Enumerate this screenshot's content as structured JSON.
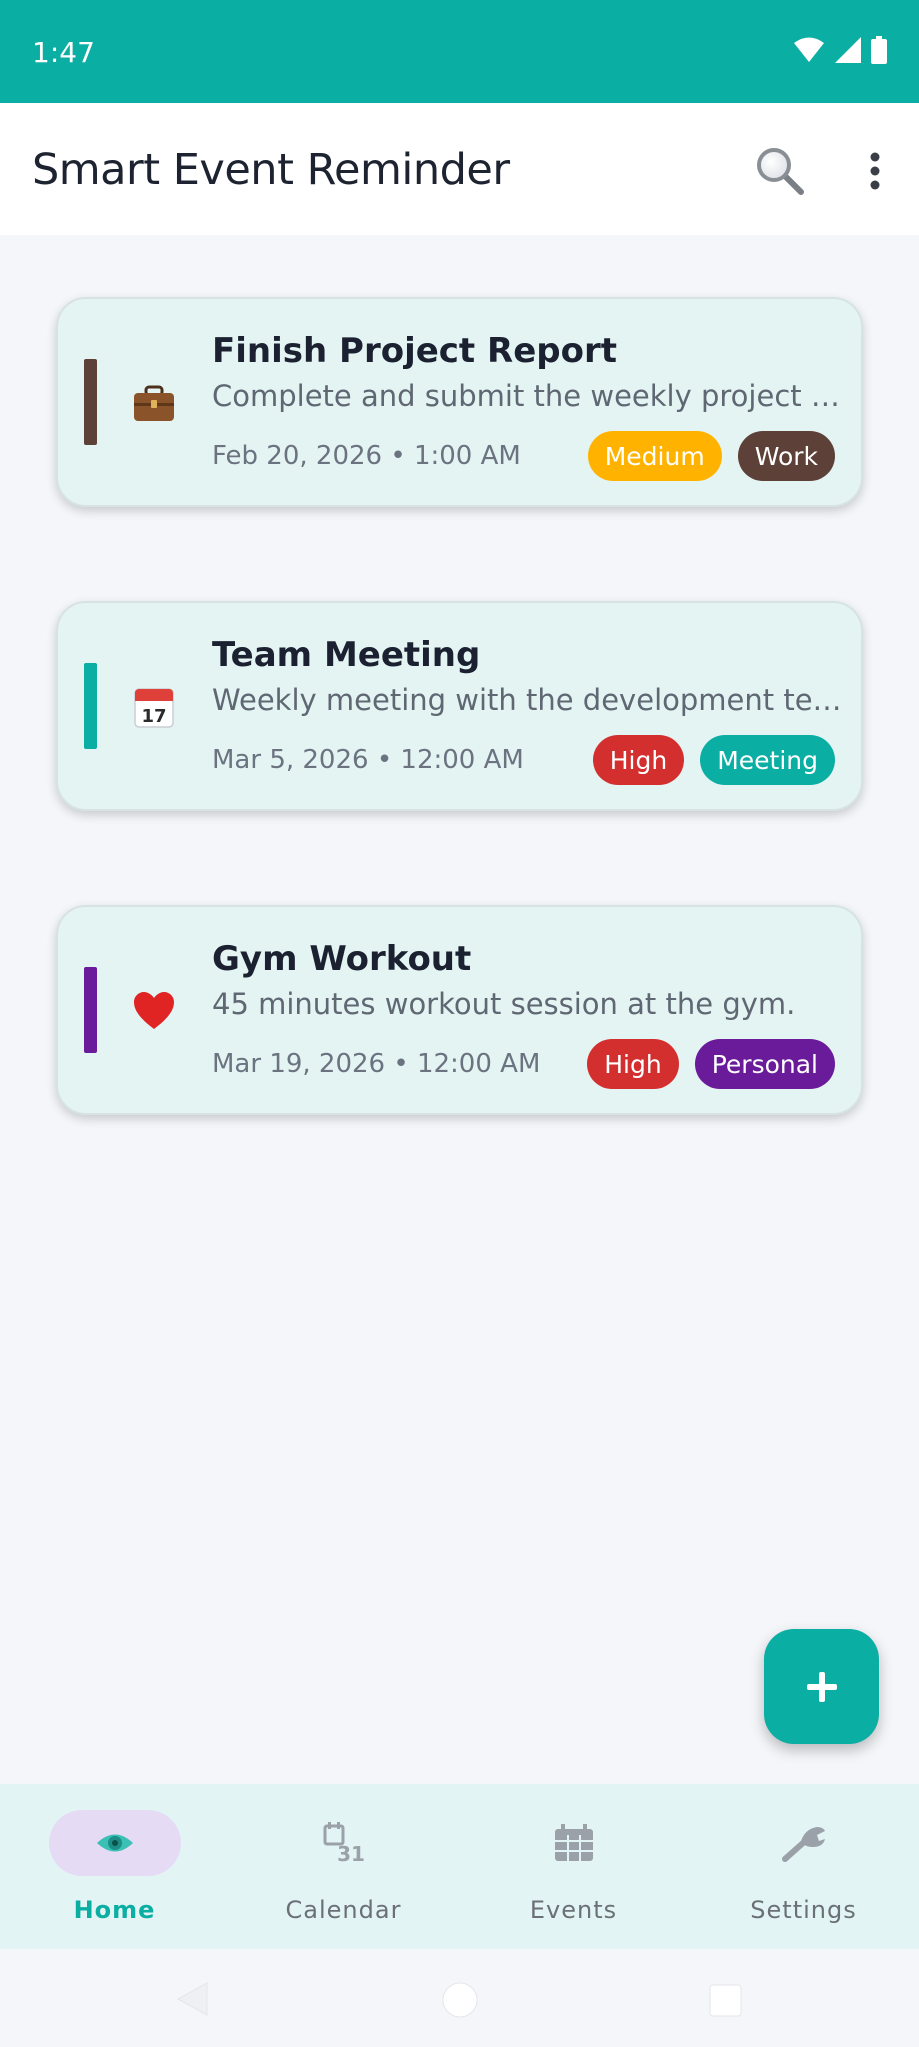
{
  "status_bar": {
    "time": "1:47"
  },
  "app_bar": {
    "title": "Smart Event Reminder",
    "search_icon": "search-icon",
    "more_icon": "more-vert-icon"
  },
  "events": [
    {
      "title": "Finish Project Report",
      "description": "Complete and submit the weekly project report to the team lead.",
      "datetime": "Feb 20, 2026 • 1:00 AM",
      "icon": "briefcase-icon",
      "accent": "#5d4037",
      "priority": {
        "label": "Medium",
        "color": "#ffb300"
      },
      "category": {
        "label": "Work",
        "color": "#5d4037"
      }
    },
    {
      "title": "Team Meeting",
      "description": "Weekly meeting with the development team on project progress.",
      "datetime": "Mar 5, 2026 • 12:00 AM",
      "icon": "calendar-icon",
      "accent": "#0baea3",
      "priority": {
        "label": "High",
        "color": "#d32f2f"
      },
      "category": {
        "label": "Meeting",
        "color": "#0baea3"
      }
    },
    {
      "title": "Gym Workout",
      "description": "45 minutes workout session at the gym.",
      "datetime": "Mar 19, 2026 • 12:00 AM",
      "icon": "heart-icon",
      "accent": "#6a1b9a",
      "priority": {
        "label": "High",
        "color": "#d32f2f"
      },
      "category": {
        "label": "Personal",
        "color": "#6a1b9a"
      }
    }
  ],
  "fab": {
    "icon": "plus-icon"
  },
  "bottom_nav": {
    "items": [
      {
        "label": "Home",
        "icon": "eye-icon",
        "active": true
      },
      {
        "label": "Calendar",
        "icon": "calendar-31-icon",
        "active": false
      },
      {
        "label": "Events",
        "icon": "events-grid-icon",
        "active": false
      },
      {
        "label": "Settings",
        "icon": "wrench-icon",
        "active": false
      }
    ]
  },
  "colors": {
    "primary": "#0baea3",
    "background": "#f4f6fa",
    "card": "#e4f4f3"
  }
}
